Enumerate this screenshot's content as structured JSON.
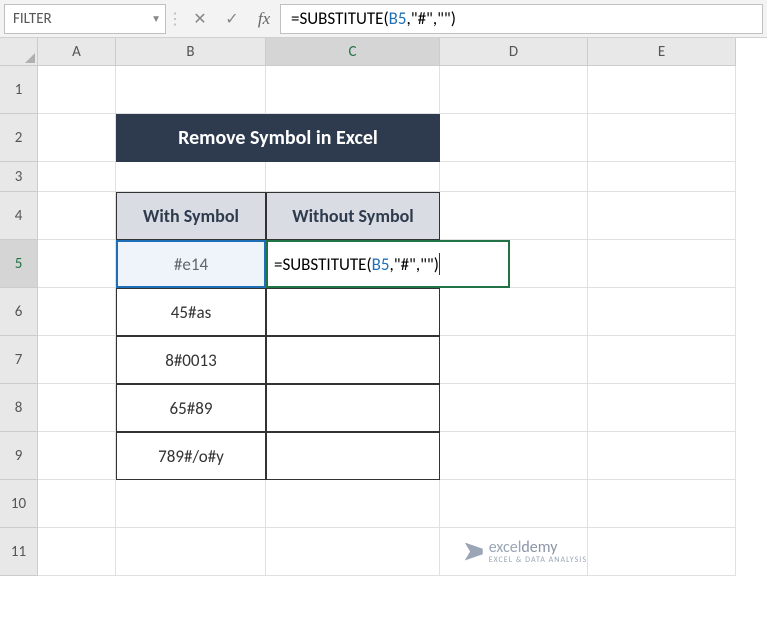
{
  "name_box": "FILTER",
  "formula_bar": {
    "prefix": "=SUBSTITUTE(",
    "ref": "B5",
    "suffix": ",\"#\",\"\")"
  },
  "columns": [
    "A",
    "B",
    "C",
    "D",
    "E"
  ],
  "rows": [
    "1",
    "2",
    "3",
    "4",
    "5",
    "6",
    "7",
    "8",
    "9",
    "10",
    "11"
  ],
  "title": "Remove Symbol in Excel",
  "table": {
    "header1": "With Symbol",
    "header2": "Without Symbol",
    "b5": "#e14",
    "b6": "45#as",
    "b7": "8#0013",
    "b8": "65#89",
    "b9": "789#/o#y"
  },
  "editing_cell": {
    "prefix": "=SUBSTITUTE(",
    "ref": "B5",
    "suffix": ",\"#\",\"\")"
  },
  "watermark": {
    "brand_light": "excel",
    "brand_bold": "demy",
    "tagline": "EXCEL & DATA ANALYSIS"
  }
}
